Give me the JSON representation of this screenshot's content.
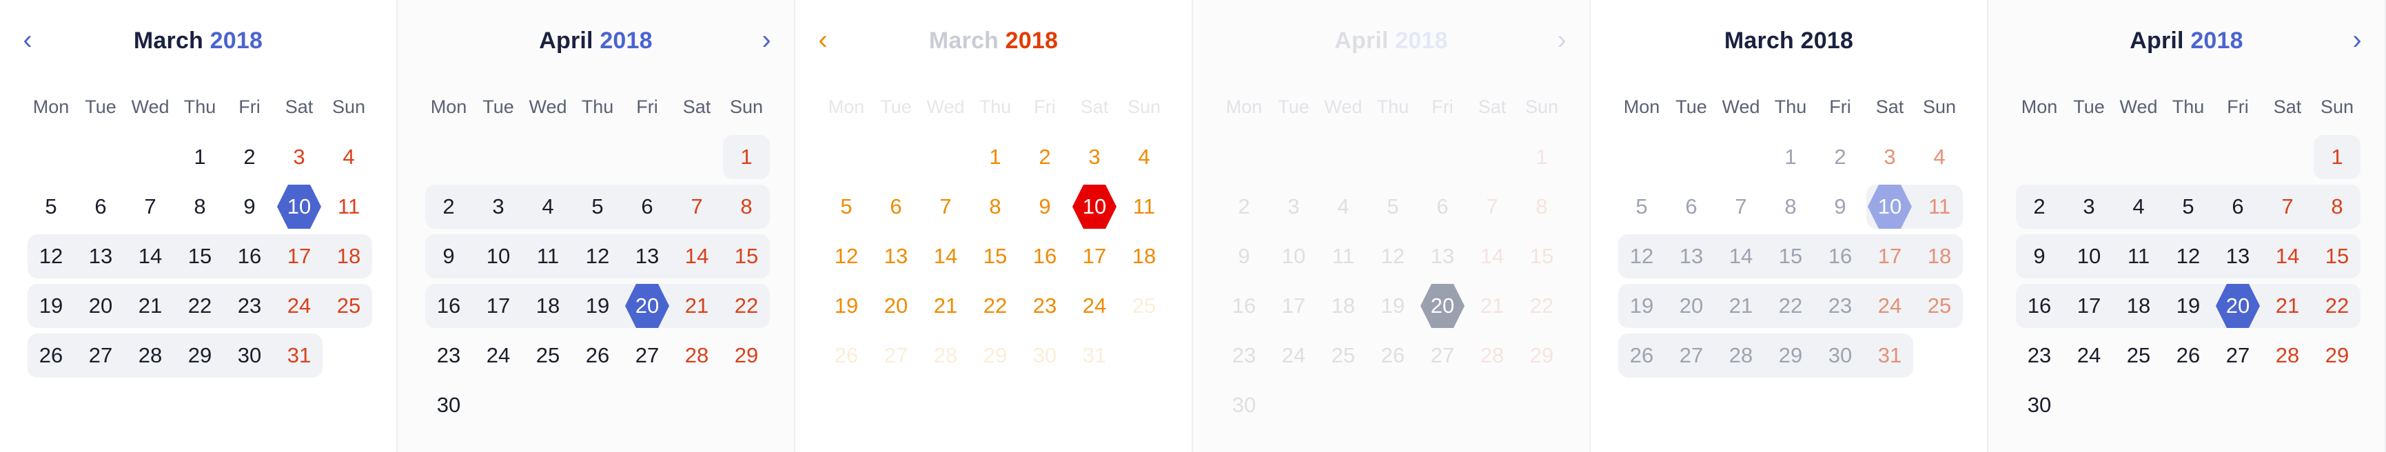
{
  "dow": [
    "Mon",
    "Tue",
    "Wed",
    "Thu",
    "Fri",
    "Sat",
    "Sun"
  ],
  "colors": {
    "accent": "#4a64d0",
    "weekend": "#d9411a",
    "orange": "#f08a00",
    "red": "#e80000",
    "text": "#1a1d2b"
  },
  "panels": [
    {
      "month": "March",
      "year": "2018",
      "prev": "‹",
      "next": "",
      "selected": 10
    },
    {
      "month": "April",
      "year": "2018",
      "prev": "",
      "next": "›",
      "selected": 20
    },
    {
      "month": "March",
      "year": "2018",
      "prev": "‹",
      "next": "",
      "selected": 10
    },
    {
      "month": "April",
      "year": "2018",
      "prev": "",
      "next": "›",
      "selected": 20
    },
    {
      "month": "March",
      "year": "2018",
      "prev": "",
      "next": "",
      "selected": 10
    },
    {
      "month": "April",
      "year": "2018",
      "prev": "",
      "next": "›",
      "selected": 20
    }
  ],
  "months": {
    "march": {
      "weeks": [
        [
          "",
          "",
          "",
          "1",
          "2",
          "3",
          "4"
        ],
        [
          "5",
          "6",
          "7",
          "8",
          "9",
          "10",
          "11"
        ],
        [
          "12",
          "13",
          "14",
          "15",
          "16",
          "17",
          "18"
        ],
        [
          "19",
          "20",
          "21",
          "22",
          "23",
          "24",
          "25"
        ],
        [
          "26",
          "27",
          "28",
          "29",
          "30",
          "31",
          ""
        ]
      ]
    },
    "april": {
      "weeks": [
        [
          "",
          "",
          "",
          "",
          "",
          "",
          "1"
        ],
        [
          "2",
          "3",
          "4",
          "5",
          "6",
          "7",
          "8"
        ],
        [
          "9",
          "10",
          "11",
          "12",
          "13",
          "14",
          "15"
        ],
        [
          "16",
          "17",
          "18",
          "19",
          "20",
          "21",
          "22"
        ],
        [
          "23",
          "24",
          "25",
          "26",
          "27",
          "28",
          "29"
        ],
        [
          "30",
          "",
          "",
          "",
          "",
          "",
          ""
        ]
      ]
    }
  }
}
